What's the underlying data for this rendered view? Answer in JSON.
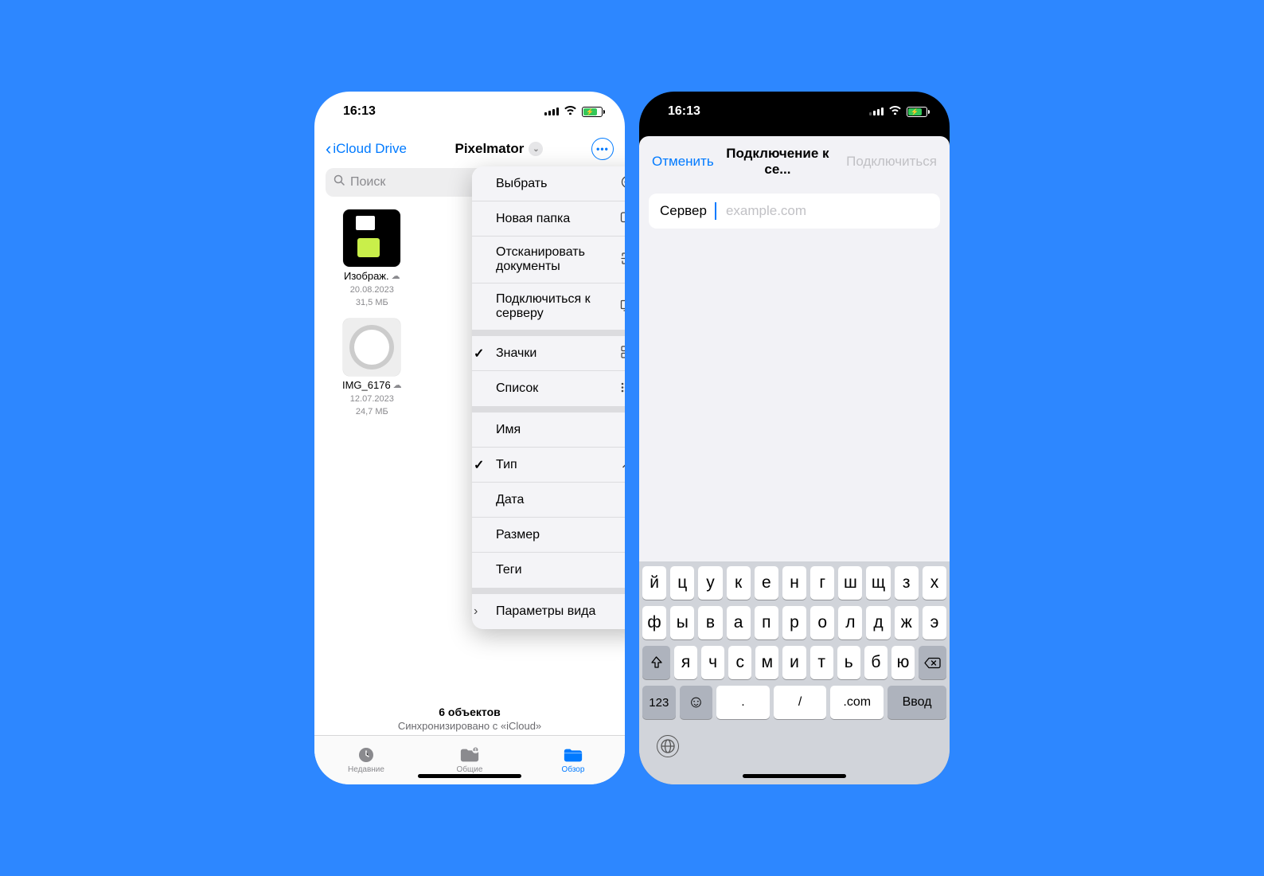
{
  "status": {
    "time": "16:13"
  },
  "phone1": {
    "back_label": "iCloud Drive",
    "title": "Pixelmator",
    "search_placeholder": "Поиск",
    "files": [
      {
        "name": "Изображ.",
        "date": "20.08.2023",
        "size": "31,5 МБ"
      },
      {
        "name": "IMG_6176",
        "date": "12.07.2023",
        "size": "24,7 МБ"
      }
    ],
    "summary": {
      "count": "6 объектов",
      "sync": "Синхронизировано с «iCloud»"
    },
    "tabs": {
      "recents": "Недавние",
      "shared": "Общие",
      "browse": "Обзор"
    },
    "menu": {
      "select": "Выбрать",
      "new_folder": "Новая папка",
      "scan": "Отсканировать документы",
      "connect": "Подключиться к серверу",
      "icons": "Значки",
      "list": "Список",
      "name": "Имя",
      "type": "Тип",
      "date": "Дата",
      "size": "Размер",
      "tags": "Теги",
      "view_params": "Параметры вида"
    }
  },
  "phone2": {
    "cancel": "Отменить",
    "title": "Подключение к се...",
    "connect": "Подключиться",
    "server_label": "Сервер",
    "server_placeholder": "example.com"
  },
  "keyboard": {
    "row1": [
      "й",
      "ц",
      "у",
      "к",
      "е",
      "н",
      "г",
      "ш",
      "щ",
      "з",
      "х"
    ],
    "row2": [
      "ф",
      "ы",
      "в",
      "а",
      "п",
      "р",
      "о",
      "л",
      "д",
      "ж",
      "э"
    ],
    "row3": [
      "я",
      "ч",
      "с",
      "м",
      "и",
      "т",
      "ь",
      "б",
      "ю"
    ],
    "num": "123",
    "dot": ".",
    "slash": "/",
    "com": ".com",
    "enter": "Ввод"
  }
}
